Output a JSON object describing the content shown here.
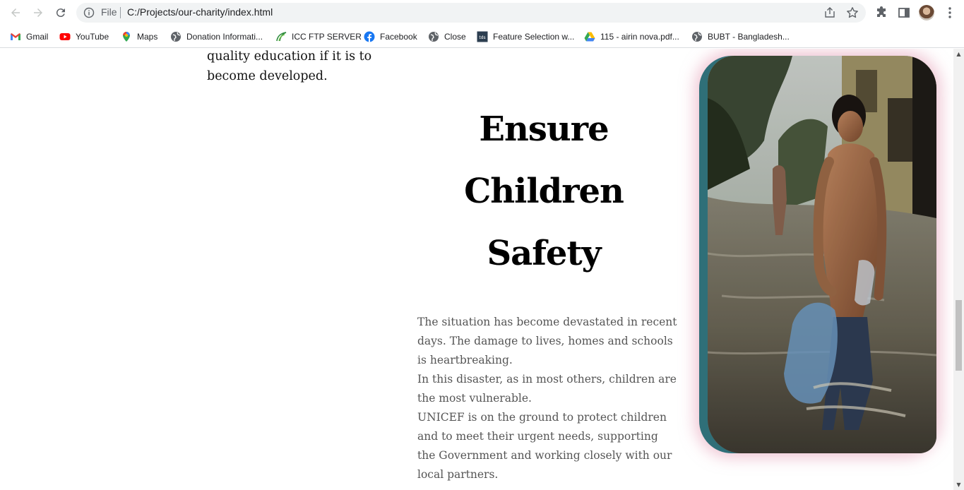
{
  "browser": {
    "omnibox": {
      "scheme_label": "File",
      "url": "C:/Projects/our-charity/index.html"
    },
    "icons": {
      "back": "arrow-left-icon",
      "forward": "arrow-right-icon",
      "reload": "reload-icon",
      "info": "info-icon",
      "share": "share-icon",
      "bookmark": "star-icon",
      "extensions": "puzzle-icon",
      "sidepanel": "side-panel-icon",
      "menu": "kebab-menu-icon"
    }
  },
  "bookmarks": [
    {
      "label": "Gmail",
      "icon": "gmail-icon"
    },
    {
      "label": "YouTube",
      "icon": "youtube-icon"
    },
    {
      "label": "Maps",
      "icon": "maps-icon"
    },
    {
      "label": "Donation Informati...",
      "icon": "globe-icon"
    },
    {
      "label": "ICC FTP SERVER",
      "icon": "leaf-icon"
    },
    {
      "label": "Facebook",
      "icon": "facebook-icon"
    },
    {
      "label": "Close",
      "icon": "globe-icon"
    },
    {
      "label": "Feature Selection w...",
      "icon": "tds-icon"
    },
    {
      "label": "115 - airin nova.pdf...",
      "icon": "google-drive-icon"
    },
    {
      "label": "BUBT - Bangladesh...",
      "icon": "globe-icon"
    }
  ],
  "page": {
    "previous_section_text": "quality education if it is to become developed.",
    "heading": "Ensure Children Safety",
    "paragraph_lines": [
      "The situation has become devastated in recent days. The damage to lives, homes and schools is heartbreaking.",
      "In this disaster, as in most others, children are the most vulnerable.",
      "UNICEF is on the ground to protect children and to meet their urgent needs, supporting the Government and working closely with our local partners."
    ],
    "image_description_icon": "flood-child-photo"
  },
  "colors": {
    "frame_teal": "#2f6f78",
    "frame_glow": "#e296af",
    "paragraph": "#555555"
  }
}
